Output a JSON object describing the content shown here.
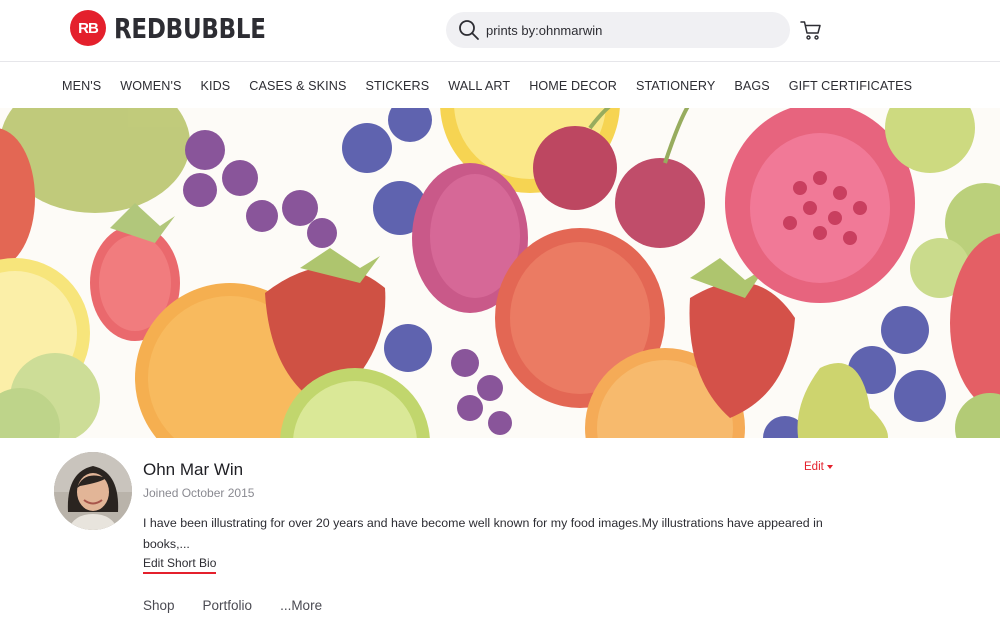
{
  "brand": {
    "logo_mark": "RB",
    "logo_text": "REDBUBBLE",
    "accent_color": "#e4202c"
  },
  "search": {
    "value": "prints by:ohnmarwin",
    "icon": "search-icon"
  },
  "cart": {
    "icon": "cart-icon"
  },
  "nav": {
    "items": [
      {
        "label": "MEN'S"
      },
      {
        "label": "WOMEN'S"
      },
      {
        "label": "KIDS"
      },
      {
        "label": "CASES & SKINS"
      },
      {
        "label": "STICKERS"
      },
      {
        "label": "WALL ART"
      },
      {
        "label": "HOME DECOR"
      },
      {
        "label": "STATIONERY"
      },
      {
        "label": "BAGS"
      },
      {
        "label": "GIFT CERTIFICATES"
      }
    ]
  },
  "profile": {
    "name": "Ohn Mar Win",
    "joined": "Joined October 2015",
    "edit_label": "Edit",
    "bio": "I have been illustrating for over 20 years and have become well known for my food images.My illustrations have appeared in books,...",
    "edit_bio_label": "Edit Short Bio",
    "tabs": [
      {
        "label": "Shop"
      },
      {
        "label": "Portfolio"
      },
      {
        "label": "...More"
      }
    ]
  }
}
